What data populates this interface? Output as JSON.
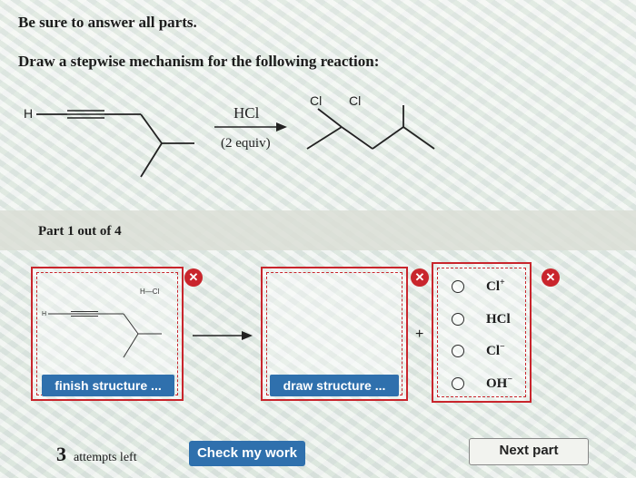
{
  "instructions": {
    "line1": "Be sure to answer all parts.",
    "line2": "Draw a stepwise mechanism for the following reaction:"
  },
  "reaction": {
    "start_label": "H",
    "reagent": "HCl",
    "equiv": "(2 equiv)",
    "product_cl_1": "Cl",
    "product_cl_2": "Cl"
  },
  "part": {
    "label": "Part 1 out of 4"
  },
  "step": {
    "box1": {
      "hcl_label": "H—Cl",
      "h_label": "H",
      "button": "finish structure ..."
    },
    "box2": {
      "button": "draw structure ..."
    },
    "plus": "+"
  },
  "options": [
    {
      "base": "Cl",
      "sup": "+"
    },
    {
      "base": "HCl",
      "sup": ""
    },
    {
      "base": "Cl",
      "sup": "−"
    },
    {
      "base": "OH",
      "sup": "−"
    }
  ],
  "footer": {
    "attempts_count": "3",
    "attempts_text": "attempts left",
    "check_button": "Check my work",
    "next_button": "Next part"
  },
  "colors": {
    "accent_red": "#c9252c",
    "button_blue": "#2f70ad"
  },
  "icons": [
    "close-icon",
    "arrow-right-icon",
    "radio-icon"
  ]
}
